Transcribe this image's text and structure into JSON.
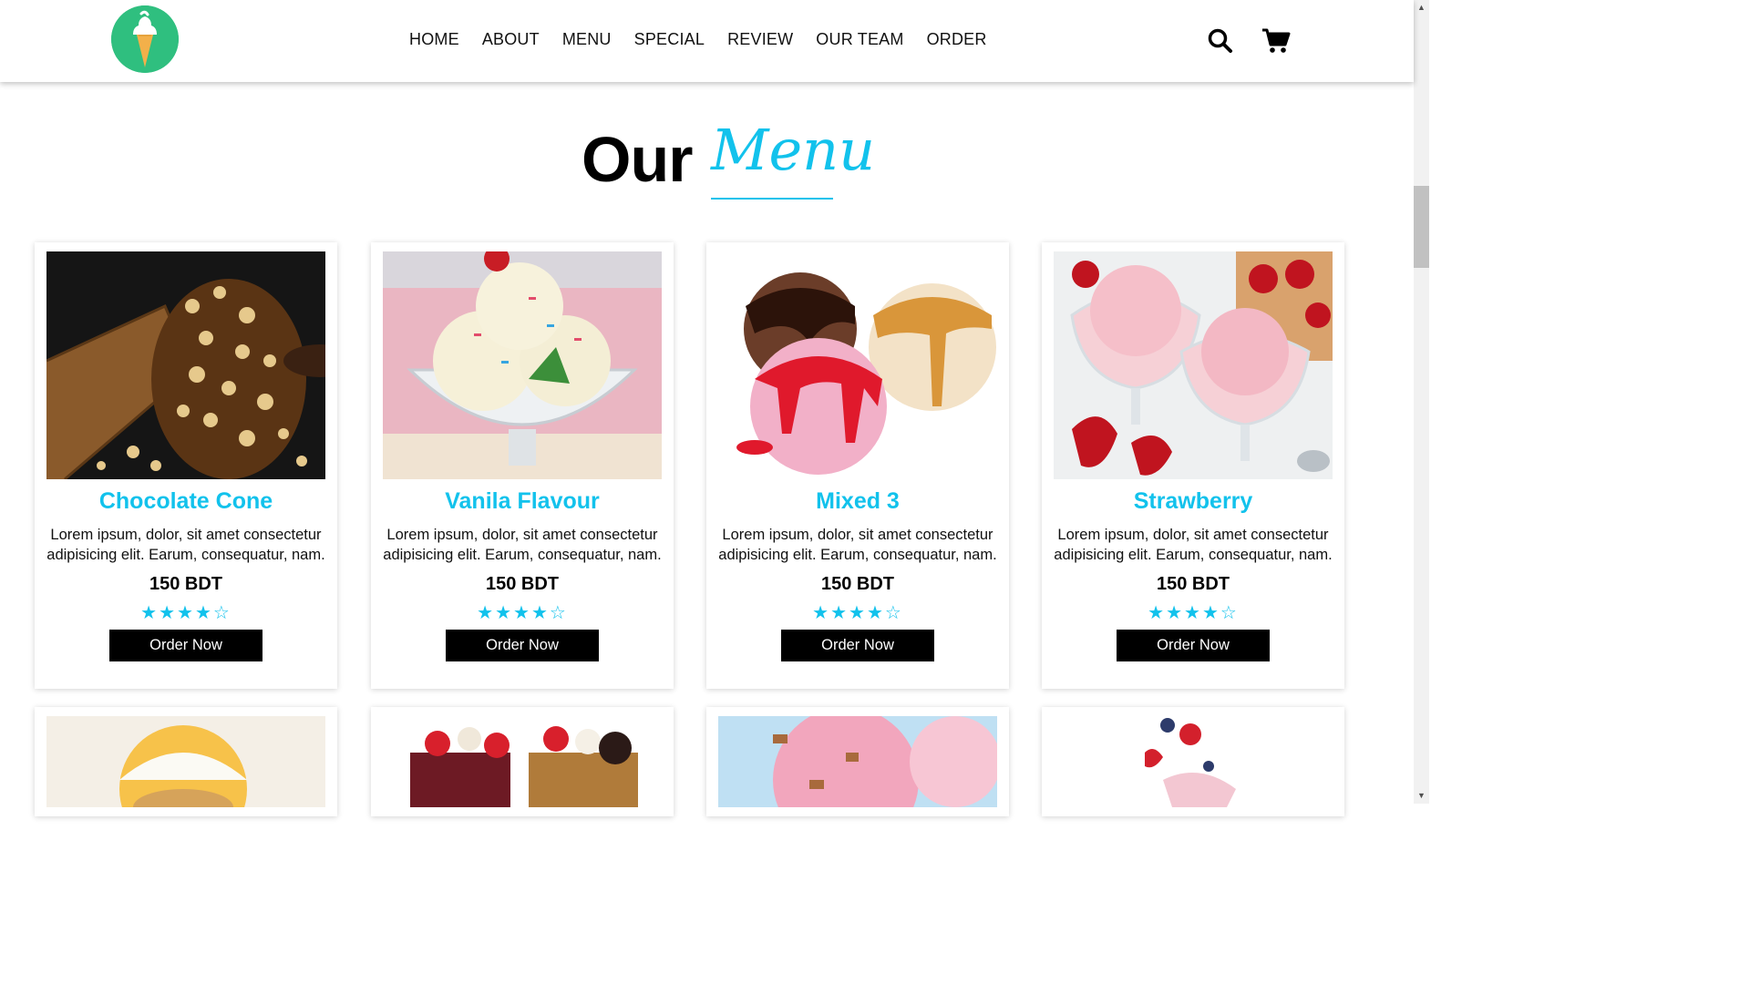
{
  "nav": {
    "items": [
      "HOME",
      "ABOUT",
      "MENU",
      "SPECIAL",
      "REVIEW",
      "OUR TEAM",
      "ORDER"
    ],
    "icons": [
      "search-icon",
      "cart-icon"
    ]
  },
  "section": {
    "title_a": "Our",
    "title_b": "Menu"
  },
  "colors": {
    "accent": "#12c2ec",
    "logo": "#2fbf7f",
    "button": "#000000"
  },
  "cards": [
    {
      "name": "Chocolate Cone",
      "desc": "Lorem ipsum, dolor, sit amet consectetur adipisicing elit. Earum, consequatur, nam.",
      "price": "150 BDT",
      "rating": 4.5,
      "button": "Order Now"
    },
    {
      "name": "Vanila Flavour",
      "desc": "Lorem ipsum, dolor, sit amet consectetur adipisicing elit. Earum, consequatur, nam.",
      "price": "150 BDT",
      "rating": 4.5,
      "button": "Order Now"
    },
    {
      "name": "Mixed 3",
      "desc": "Lorem ipsum, dolor, sit amet consectetur adipisicing elit. Earum, consequatur, nam.",
      "price": "150 BDT",
      "rating": 4.5,
      "button": "Order Now"
    },
    {
      "name": "Strawberry",
      "desc": "Lorem ipsum, dolor, sit amet consectetur adipisicing elit. Earum, consequatur, nam.",
      "price": "150 BDT",
      "rating": 4.5,
      "button": "Order Now"
    }
  ]
}
